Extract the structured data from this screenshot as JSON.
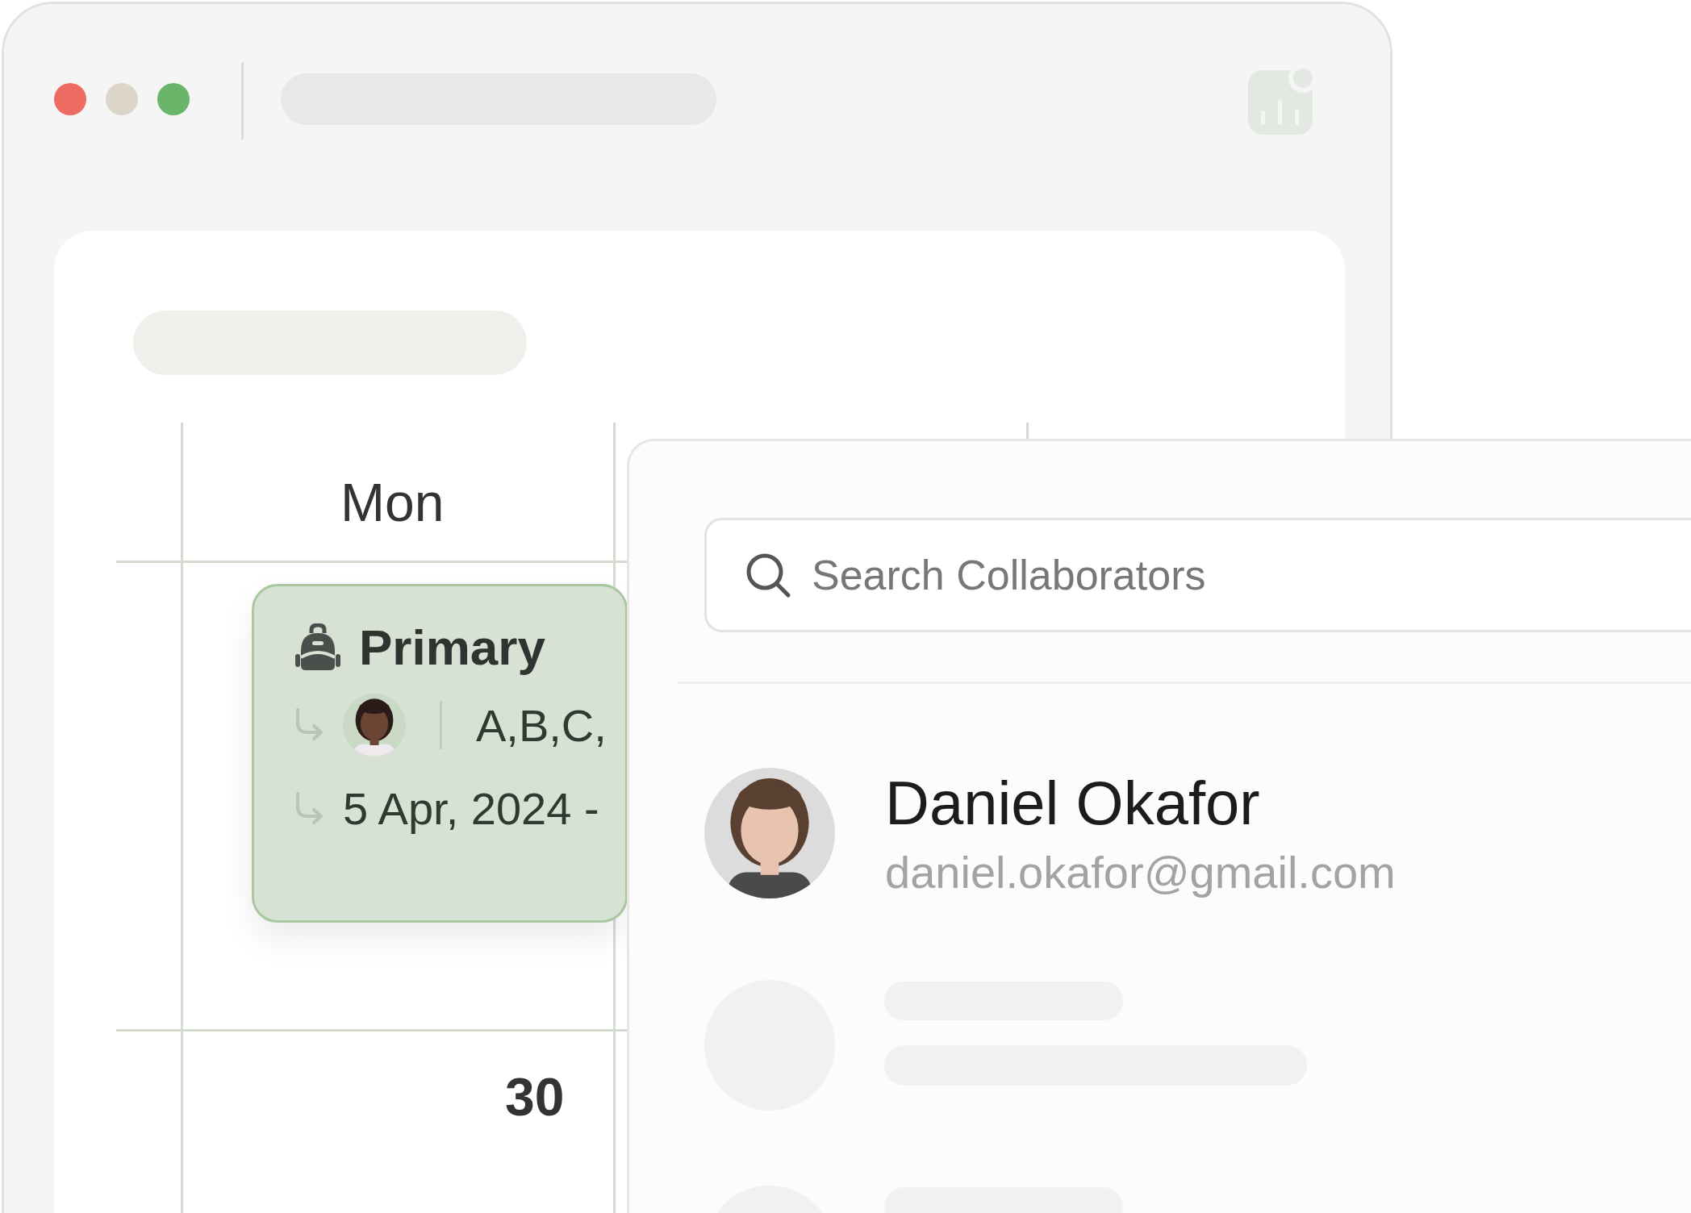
{
  "window": {
    "controls": [
      {
        "color": "#ee6b62"
      },
      {
        "color": "#dcd6c8"
      },
      {
        "color": "#6ab56a"
      }
    ]
  },
  "calendar": {
    "day_header": "Mon",
    "date": "30",
    "event": {
      "title": "Primary",
      "collaborators": "A,B,C,",
      "date_range": "5 Apr, 2024 -"
    }
  },
  "collaborator_panel": {
    "search": {
      "placeholder": "Search Collaborators"
    },
    "collaborators": [
      {
        "name": "Daniel Okafor",
        "email": "daniel.okafor@gmail.com"
      }
    ]
  }
}
